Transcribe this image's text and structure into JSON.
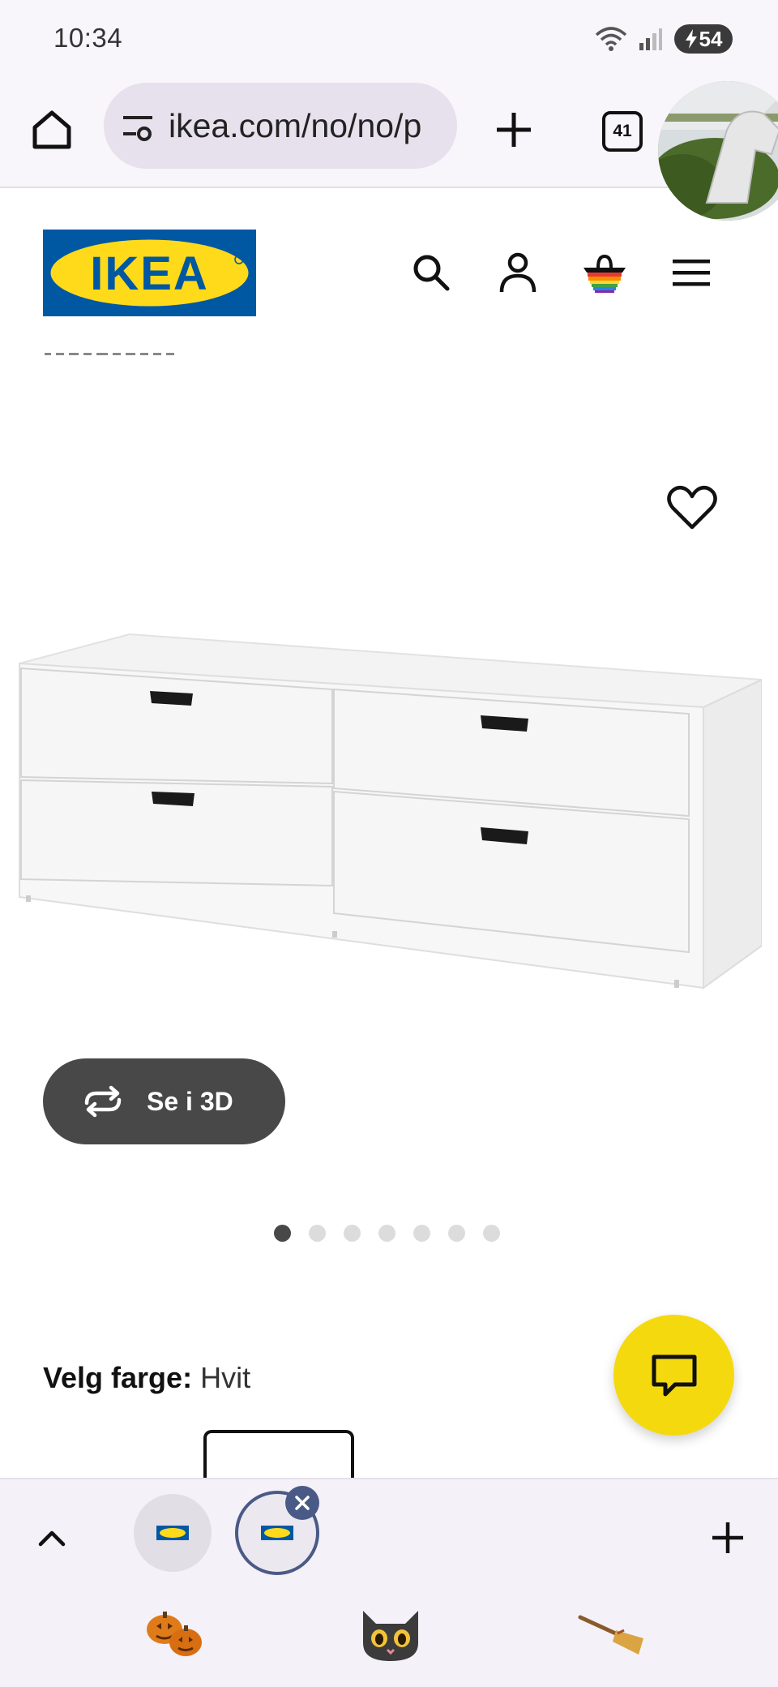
{
  "status_bar": {
    "time": "10:34",
    "battery": "54"
  },
  "browser": {
    "url": "ikea.com/no/no/p",
    "tab_count": "41"
  },
  "ikea": {
    "logo_text": "IKEA"
  },
  "product": {
    "view_3d_label": "Se i 3D",
    "image_count": 7,
    "active_image": 1,
    "color_label": "Velg farge:",
    "color_value": "Hvit"
  },
  "tabstrip": {
    "tabs": [
      {
        "favicon": "ikea-favicon"
      },
      {
        "favicon": "ikea-favicon",
        "active": true
      }
    ],
    "decorations": [
      "pumpkins-emoji",
      "black-cat-emoji",
      "broom-emoji"
    ]
  },
  "colors": {
    "ikea_blue": "#0058a3",
    "ikea_yellow": "#ffda1a",
    "chat_fab": "#f5d90f",
    "button_dark": "#484848",
    "active_tab_ring": "#4a5a86"
  }
}
